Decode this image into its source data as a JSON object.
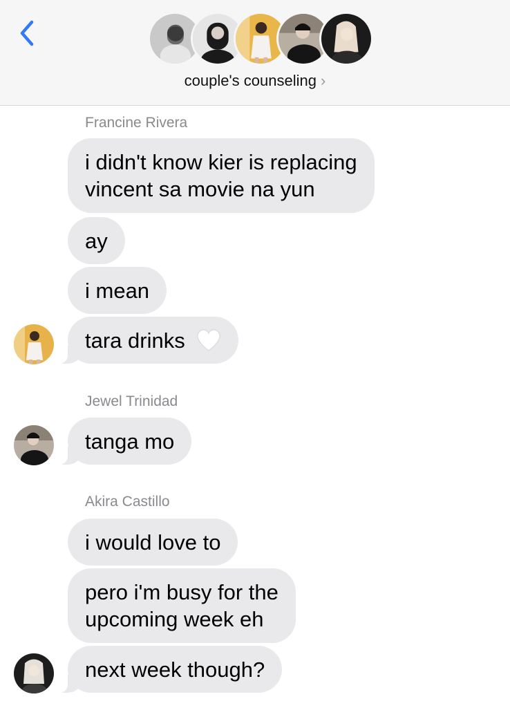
{
  "header": {
    "group_name": "couple's counseling",
    "chevron": "›",
    "back_icon": "chevron-left-icon",
    "accent_color": "#3478f6",
    "member_avatar_count": 5
  },
  "messages": [
    {
      "sender": "Francine Rivera",
      "bubbles": [
        "i didn't know kier is replacing\nvincent sa movie na yun",
        "ay",
        "i mean",
        "tara drinks"
      ],
      "emoji": "white-heart"
    },
    {
      "sender": "Jewel Trinidad",
      "bubbles": [
        "tanga mo"
      ]
    },
    {
      "sender": "Akira Castillo",
      "bubbles": [
        "i would love to",
        "pero i'm busy for the\nupcoming week eh",
        "next week though?"
      ]
    }
  ],
  "colors": {
    "bubble_bg": "#e9e9eb",
    "sender_text": "#8a8a8e",
    "header_bg": "#f6f6f6"
  }
}
